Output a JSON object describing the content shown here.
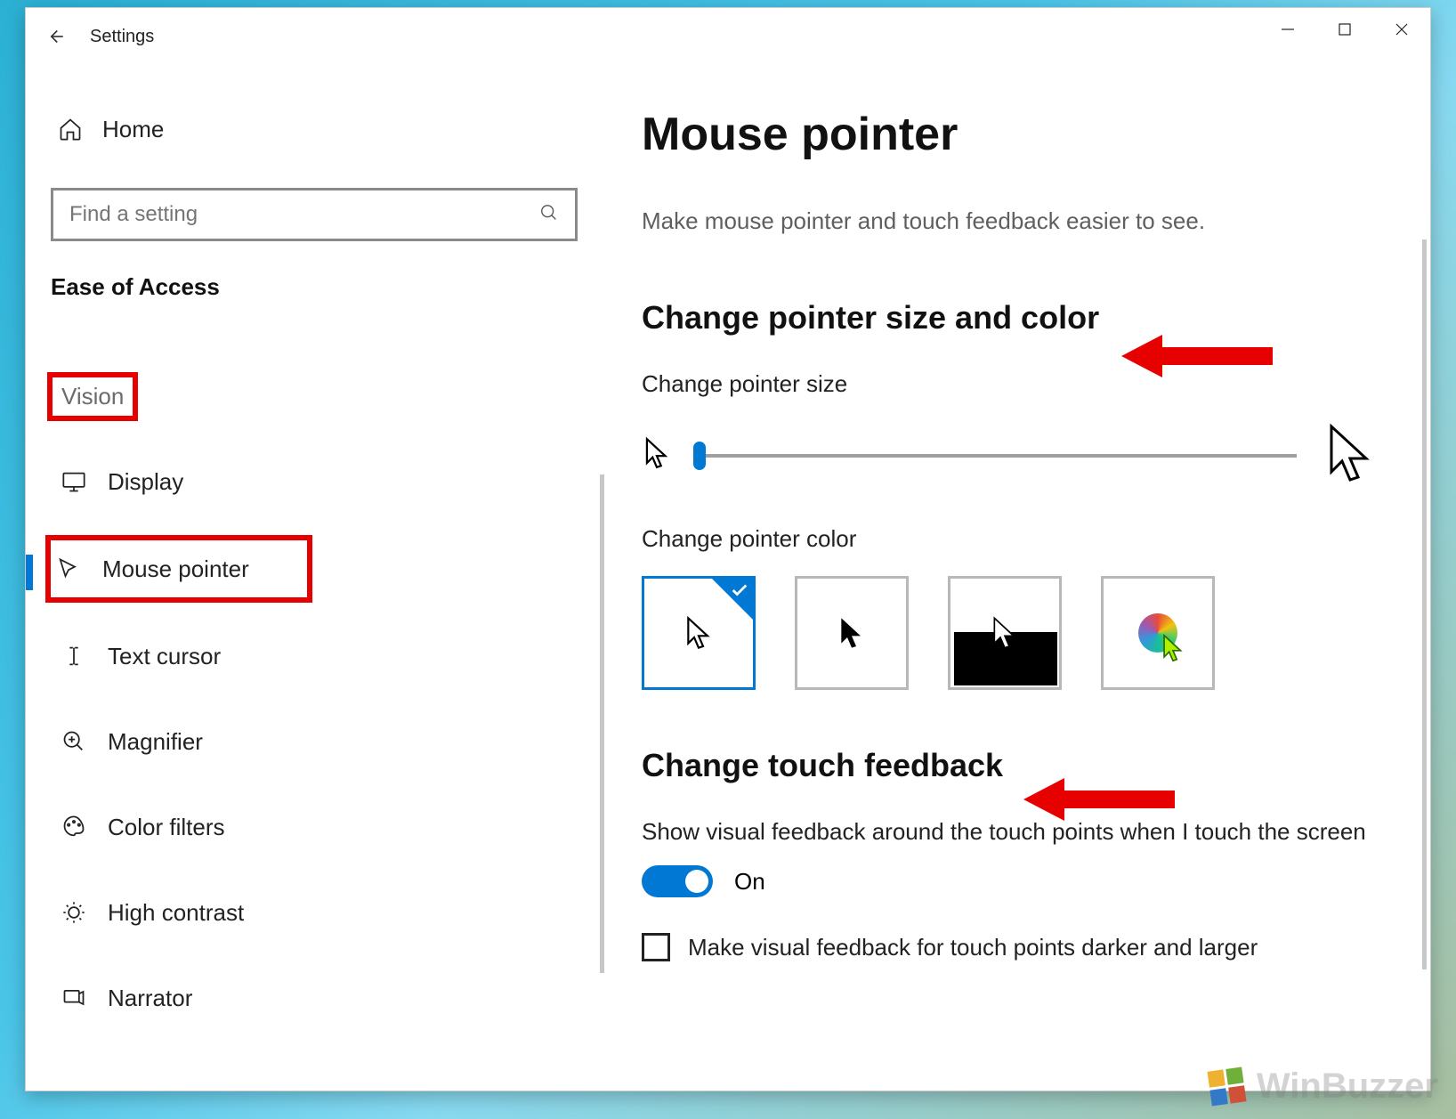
{
  "window": {
    "title": "Settings"
  },
  "sidebar": {
    "home": "Home",
    "search_placeholder": "Find a setting",
    "category": "Ease of Access",
    "group": "Vision",
    "items": [
      {
        "label": "Display"
      },
      {
        "label": "Mouse pointer"
      },
      {
        "label": "Text cursor"
      },
      {
        "label": "Magnifier"
      },
      {
        "label": "Color filters"
      },
      {
        "label": "High contrast"
      },
      {
        "label": "Narrator"
      }
    ]
  },
  "content": {
    "title": "Mouse pointer",
    "description": "Make mouse pointer and touch feedback easier to see.",
    "section1_title": "Change pointer size and color",
    "size_label": "Change pointer size",
    "color_label": "Change pointer color",
    "section2_title": "Change touch feedback",
    "touch_desc": "Show visual feedback around the touch points when I touch the screen",
    "toggle_state": "On",
    "checkbox_label": "Make visual feedback for touch points darker and larger"
  },
  "watermark": "WinBuzzer"
}
